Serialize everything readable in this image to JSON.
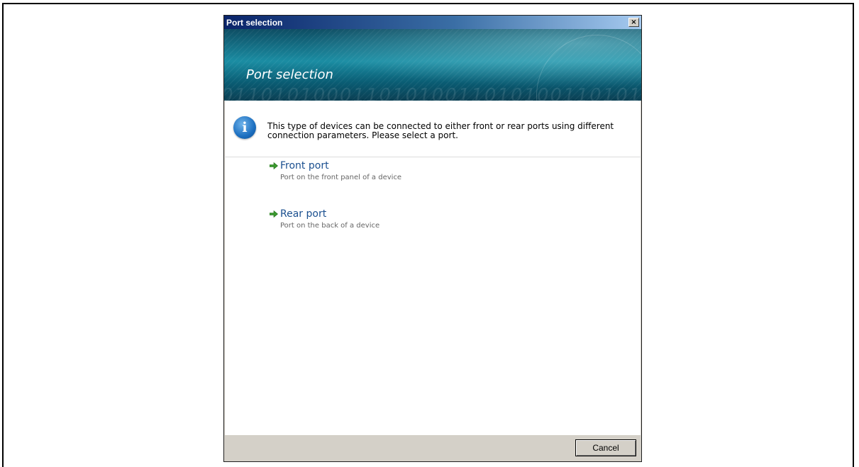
{
  "dialog": {
    "window_title": "Port selection",
    "close_glyph": "×",
    "banner_title": "Port selection",
    "info_text": "This type of devices can be connected to either front or rear ports using different connection parameters. Please select a port.",
    "info_icon": "i",
    "options": [
      {
        "label": "Front port",
        "description": "Port on the front panel of a device",
        "icon": "green-arrow-icon"
      },
      {
        "label": "Rear port",
        "description": "Port on the back of a device",
        "icon": "green-arrow-icon"
      }
    ],
    "cancel_label": "Cancel"
  },
  "colors": {
    "titlebar_start": "#0a246a",
    "banner": "#1b8da3",
    "link": "#1a4f8f",
    "arrow": "#3a9a2e"
  }
}
